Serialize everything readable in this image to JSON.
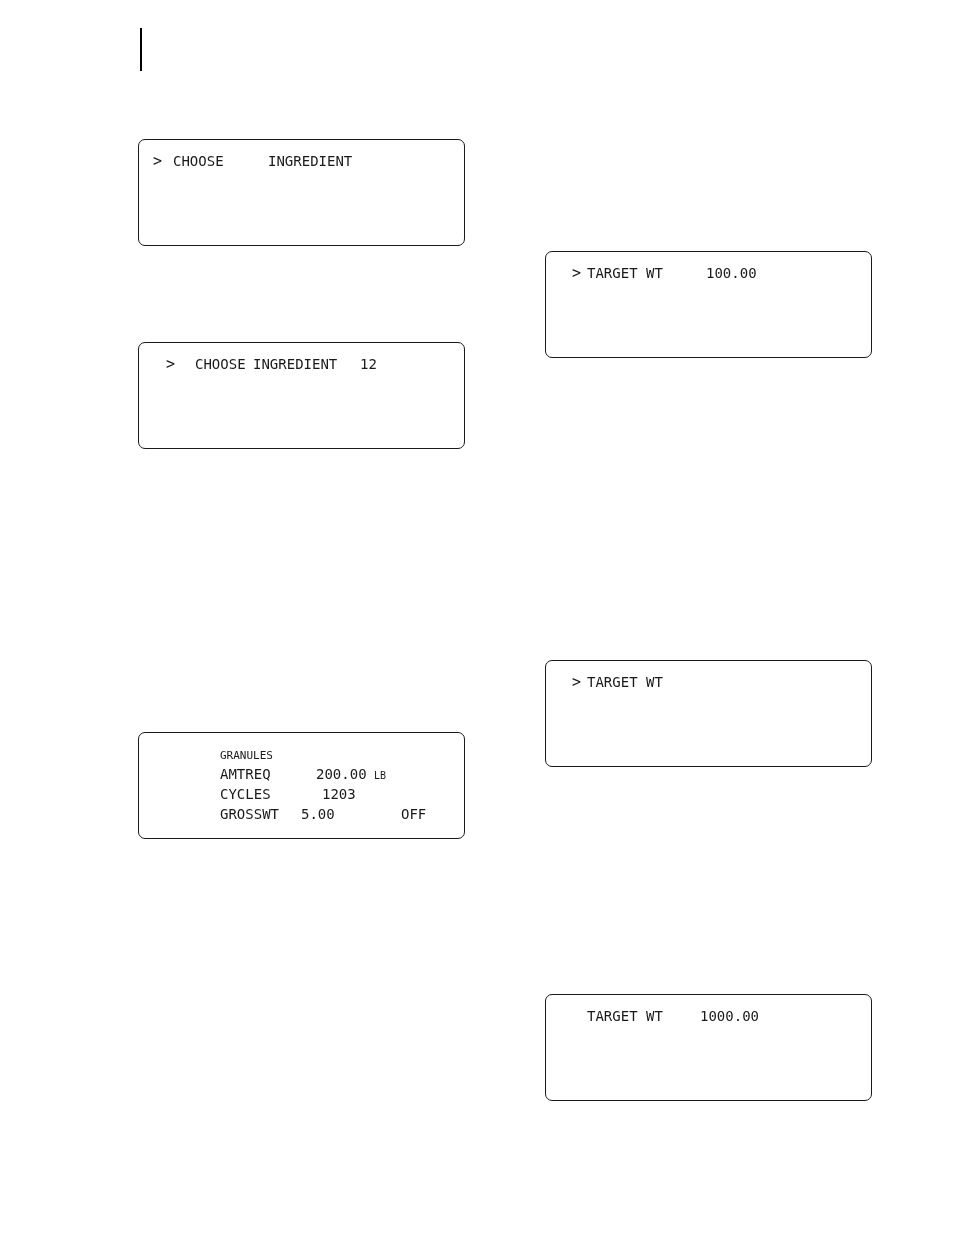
{
  "left_column": {
    "displays": [
      {
        "lines": [
          {
            "segments": [
              {
                "kind": "cursor",
                "text": ">"
              },
              {
                "kind": "text",
                "text": "CHOOSE"
              },
              {
                "kind": "text",
                "text": "INGREDIENT"
              }
            ]
          }
        ]
      },
      {
        "lines": [
          {
            "segments": [
              {
                "kind": "cursor",
                "text": ">"
              },
              {
                "kind": "text",
                "text": "CHOOSE"
              },
              {
                "kind": "text",
                "text": "INGREDIENT"
              },
              {
                "kind": "text",
                "text": "12"
              }
            ]
          }
        ]
      },
      {
        "lines": [
          {
            "segments": [
              {
                "kind": "title",
                "text": "GRANULES"
              }
            ]
          },
          {
            "segments": [
              {
                "kind": "text",
                "text": "AMTREQ"
              },
              {
                "kind": "text",
                "text": "200.00"
              },
              {
                "kind": "unit",
                "text": "LB"
              }
            ]
          },
          {
            "segments": [
              {
                "kind": "text",
                "text": "CYCLES"
              },
              {
                "kind": "text",
                "text": "1203"
              }
            ]
          },
          {
            "segments": [
              {
                "kind": "text",
                "text": "GROSSWT"
              },
              {
                "kind": "text",
                "text": "5.00"
              },
              {
                "kind": "text",
                "text": "OFF"
              }
            ]
          }
        ]
      }
    ]
  },
  "right_column": {
    "displays": [
      {
        "lines": [
          {
            "segments": [
              {
                "kind": "cursor",
                "text": ">"
              },
              {
                "kind": "text",
                "text": "TARGET WT"
              },
              {
                "kind": "text",
                "text": "100.00"
              }
            ]
          }
        ]
      },
      {
        "lines": [
          {
            "segments": [
              {
                "kind": "cursor",
                "text": ">"
              },
              {
                "kind": "text",
                "text": "TARGET WT"
              }
            ]
          }
        ]
      },
      {
        "lines": [
          {
            "segments": [
              {
                "kind": "text",
                "text": "TARGET WT"
              },
              {
                "kind": "text",
                "text": "1000.00"
              }
            ]
          }
        ]
      }
    ]
  }
}
